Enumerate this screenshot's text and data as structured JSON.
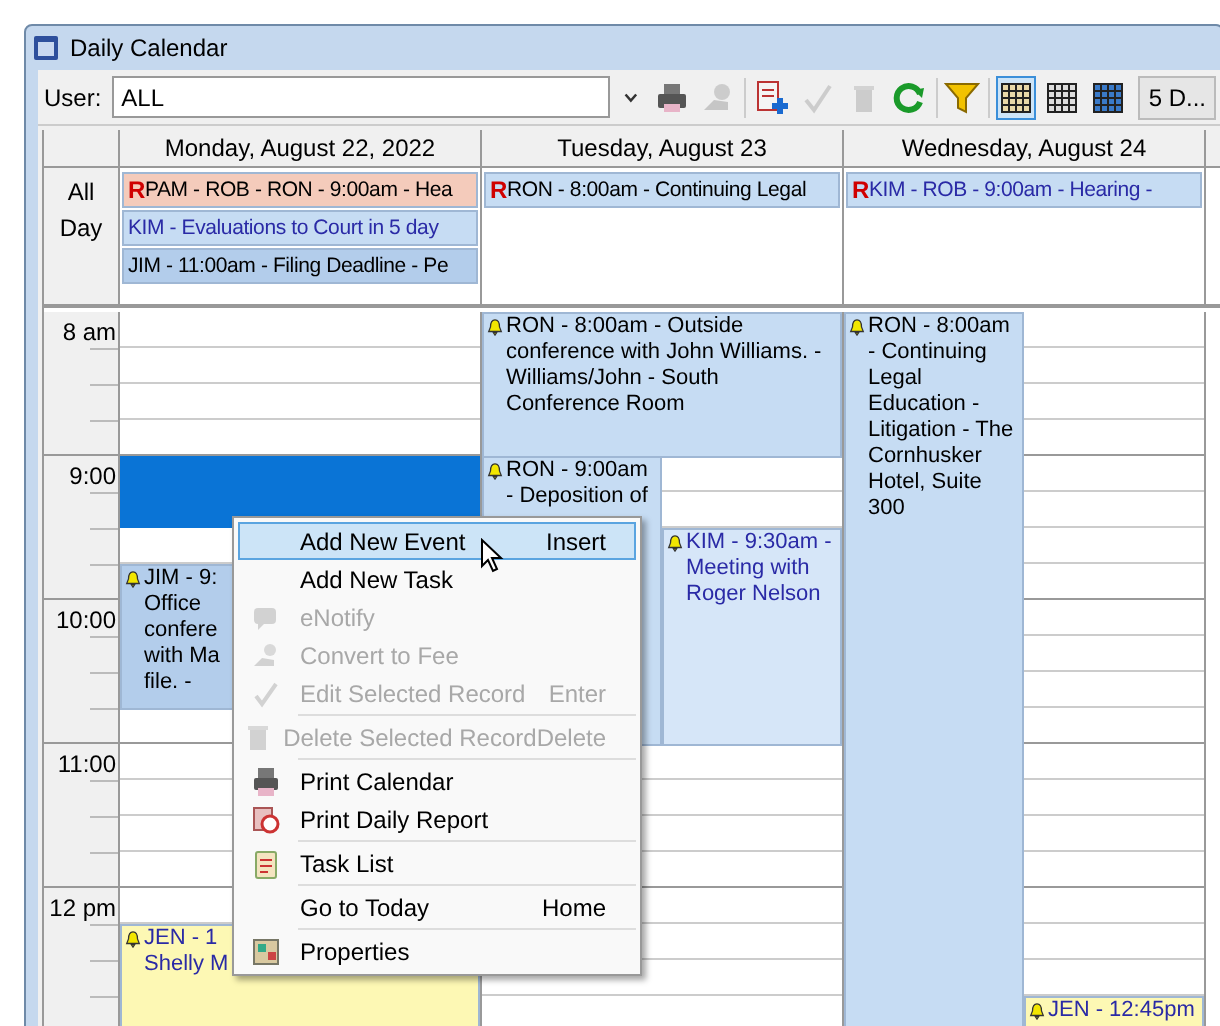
{
  "window": {
    "title": "Daily Calendar"
  },
  "toolbar": {
    "user_label": "User:",
    "user_value": "ALL",
    "view_buttons": [
      {
        "selected": true
      },
      {
        "selected": false
      },
      {
        "selected": false
      }
    ],
    "range_button": "5 D..."
  },
  "all_day_label": "All Day",
  "time_labels": [
    "8 am",
    "9:00",
    "10:00",
    "11:00",
    "12 pm"
  ],
  "days": [
    {
      "title": "Monday, August 22, 2022",
      "selected_slots": true,
      "all_day": [
        {
          "mark": "R",
          "text": "PAM - ROB - RON - 9:00am - Hea",
          "color": "#f4cbbb"
        },
        {
          "text": "KIM - Evaluations to Court in 5 day",
          "color": "#c6dcf3"
        },
        {
          "text": "JIM - 11:00am - Filing Deadline - Pe",
          "color": "#b3cdeb"
        }
      ],
      "events": [
        {
          "alarm": true,
          "text": "JIM - 9:\nOffice\nconfere\nwith Ma\nfile. -",
          "color": "#b3cdeb"
        },
        {
          "alarm": true,
          "text": "JEN - 1\nShelly M",
          "color": "#fdf8b4"
        }
      ]
    },
    {
      "title": "Tuesday, August 23",
      "all_day": [
        {
          "mark": "R",
          "text": "RON - 8:00am - Continuing Legal",
          "color": "#c6dcf3"
        }
      ],
      "events": [
        {
          "alarm": true,
          "text": "RON - 8:00am - Outside conference with John Williams. - Williams/John - South Conference Room",
          "color": "#c6dcf3"
        },
        {
          "alarm": true,
          "text": "RON - 9:00am\n- Deposition of",
          "color": "#c6dcf3"
        },
        {
          "alarm": true,
          "text": "KIM - 9:30am - Meeting with Roger Nelson",
          "color": "#d6e6f8"
        }
      ]
    },
    {
      "title": "Wednesday, August 24",
      "all_day": [
        {
          "mark": "R",
          "text": "KIM - ROB - 9:00am - Hearing - ",
          "color": "#c6dcf3"
        }
      ],
      "events": [
        {
          "alarm": true,
          "text": "RON - 8:00am - Continuing Legal Education - Litigation - The Cornhusker Hotel, Suite 300",
          "color": "#c6dcf3"
        },
        {
          "alarm": true,
          "text": "JEN - 12:45pm",
          "color": "#fdf8b4"
        }
      ]
    }
  ],
  "context_menu": [
    {
      "label": "Add New Event",
      "shortcut": "Insert",
      "disabled": false,
      "selected": true
    },
    {
      "label": "Add New Task",
      "disabled": false,
      "selected": false
    },
    {
      "label": "eNotify",
      "disabled": true,
      "selected": false
    },
    {
      "label": "Convert to Fee",
      "disabled": true,
      "selected": false
    },
    {
      "label": "Edit Selected Record",
      "shortcut": "Enter",
      "disabled": true,
      "selected": false,
      "separator_after": true
    },
    {
      "label": "Delete Selected Record",
      "shortcut": "Delete",
      "disabled": true,
      "selected": false,
      "separator_after": true
    },
    {
      "label": "Print Calendar",
      "disabled": false,
      "selected": false
    },
    {
      "label": "Print Daily Report",
      "disabled": false,
      "selected": false,
      "separator_after": true
    },
    {
      "label": "Task List",
      "disabled": false,
      "selected": false,
      "separator_after": true
    },
    {
      "label": "Go to Today",
      "shortcut": "Home",
      "disabled": false,
      "selected": false,
      "separator_after": true
    },
    {
      "label": "Properties",
      "disabled": false,
      "selected": false
    }
  ]
}
